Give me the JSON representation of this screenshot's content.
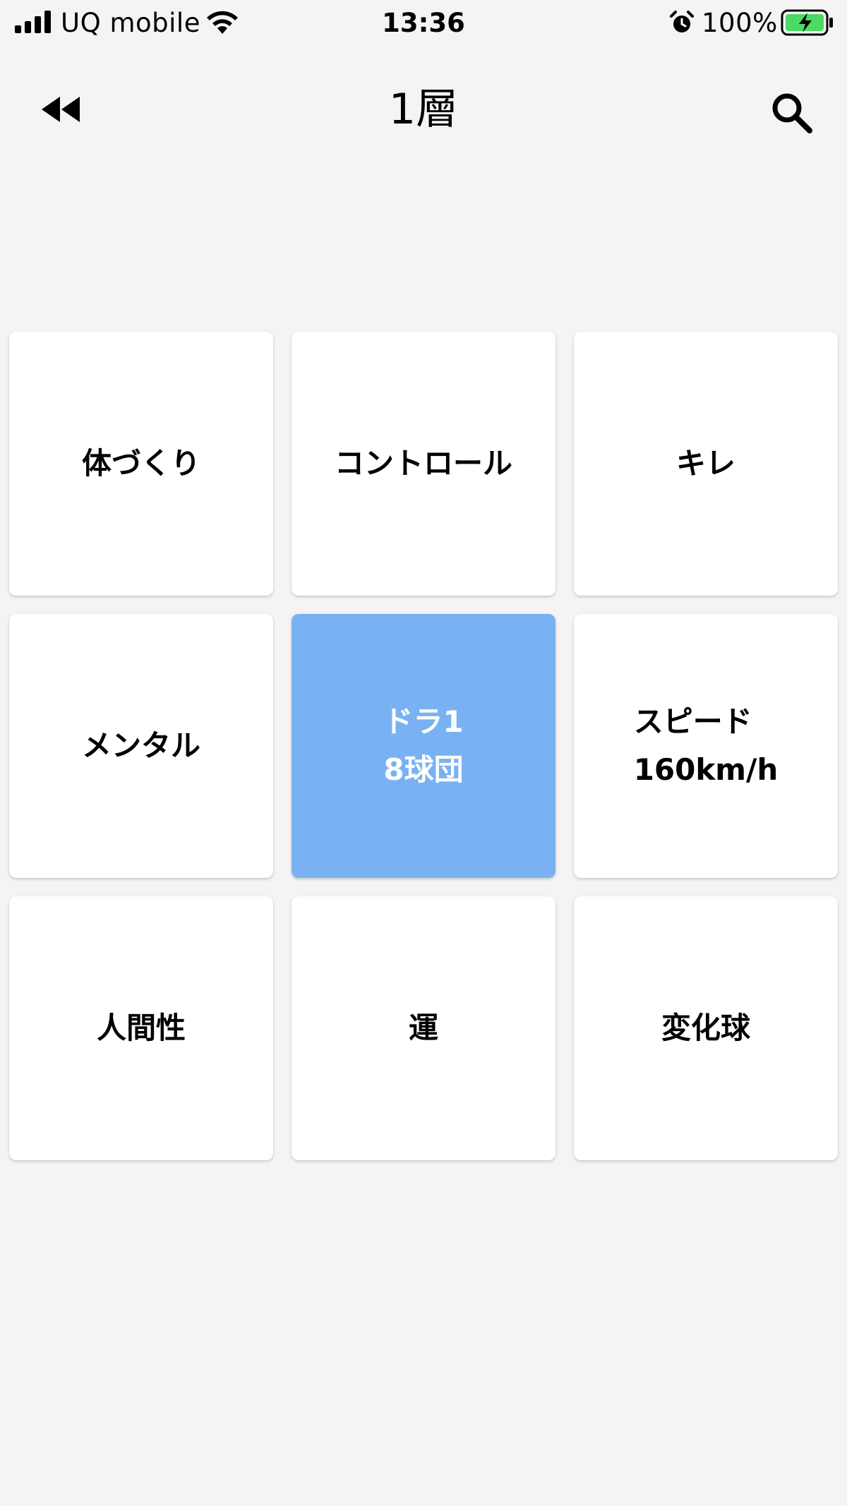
{
  "status_bar": {
    "carrier": "UQ mobile",
    "time": "13:36",
    "battery_percent": "100%",
    "icons": [
      "signal-icon",
      "wifi-icon",
      "alarm-icon",
      "battery-charging-icon"
    ]
  },
  "nav": {
    "title": "1層",
    "back_icon": "double-chevron-left-icon",
    "search_icon": "search-icon"
  },
  "grid": {
    "cells": [
      {
        "label": "体づくり"
      },
      {
        "label": "コントロール"
      },
      {
        "label": "キレ"
      },
      {
        "label": "メンタル"
      },
      {
        "label": "ドラ1\n8球団"
      },
      {
        "label": "スピード\n160km/h"
      },
      {
        "label": "人間性"
      },
      {
        "label": "運"
      },
      {
        "label": "変化球"
      }
    ]
  },
  "colors": {
    "background": "#f4f4f4",
    "cell": "#ffffff",
    "center_cell": "#78b2f2",
    "center_text": "#ffffff",
    "battery_fill": "#4cd964"
  }
}
